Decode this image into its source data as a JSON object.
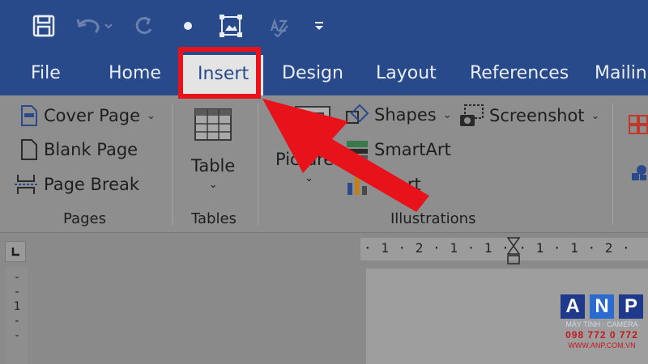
{
  "tabs": [
    {
      "label": "File"
    },
    {
      "label": "Home"
    },
    {
      "label": "Insert"
    },
    {
      "label": "Design"
    },
    {
      "label": "Layout"
    },
    {
      "label": "References"
    },
    {
      "label": "Mailing"
    }
  ],
  "active_tab": "Insert",
  "ribbon": {
    "pages": {
      "cover_page": "Cover Page",
      "blank_page": "Blank Page",
      "page_break": "Page Break",
      "label": "Pages"
    },
    "tables": {
      "table": "Table",
      "label": "Tables"
    },
    "illustrations": {
      "pictures": "Pictures",
      "shapes": "Shapes",
      "smartart": "SmartArt",
      "chart": "Chart",
      "screenshot": "Screenshot",
      "label": "Illustrations"
    }
  },
  "ruler": {
    "horizontal": "· 1 · 2 · 1 · 1 ·   · 1 · 1 · 2 ·",
    "vertical": "-\n-\n1\n-\n-"
  },
  "watermark": {
    "letters": [
      "A",
      "N",
      "P"
    ],
    "tagline": "MÁY TÍNH · CAMERA",
    "phone": "098 772 0 772",
    "url": "WWW.ANP.COM.VN"
  },
  "colors": {
    "title_bar": "#28498a",
    "highlight": "#e8121a",
    "ribbon_dimmed": "#8e8e8e"
  },
  "icons": [
    "save-icon",
    "undo-icon",
    "redo-icon",
    "touch-mode-icon",
    "select-objects-icon",
    "spelling-icon",
    "customize-icon"
  ]
}
